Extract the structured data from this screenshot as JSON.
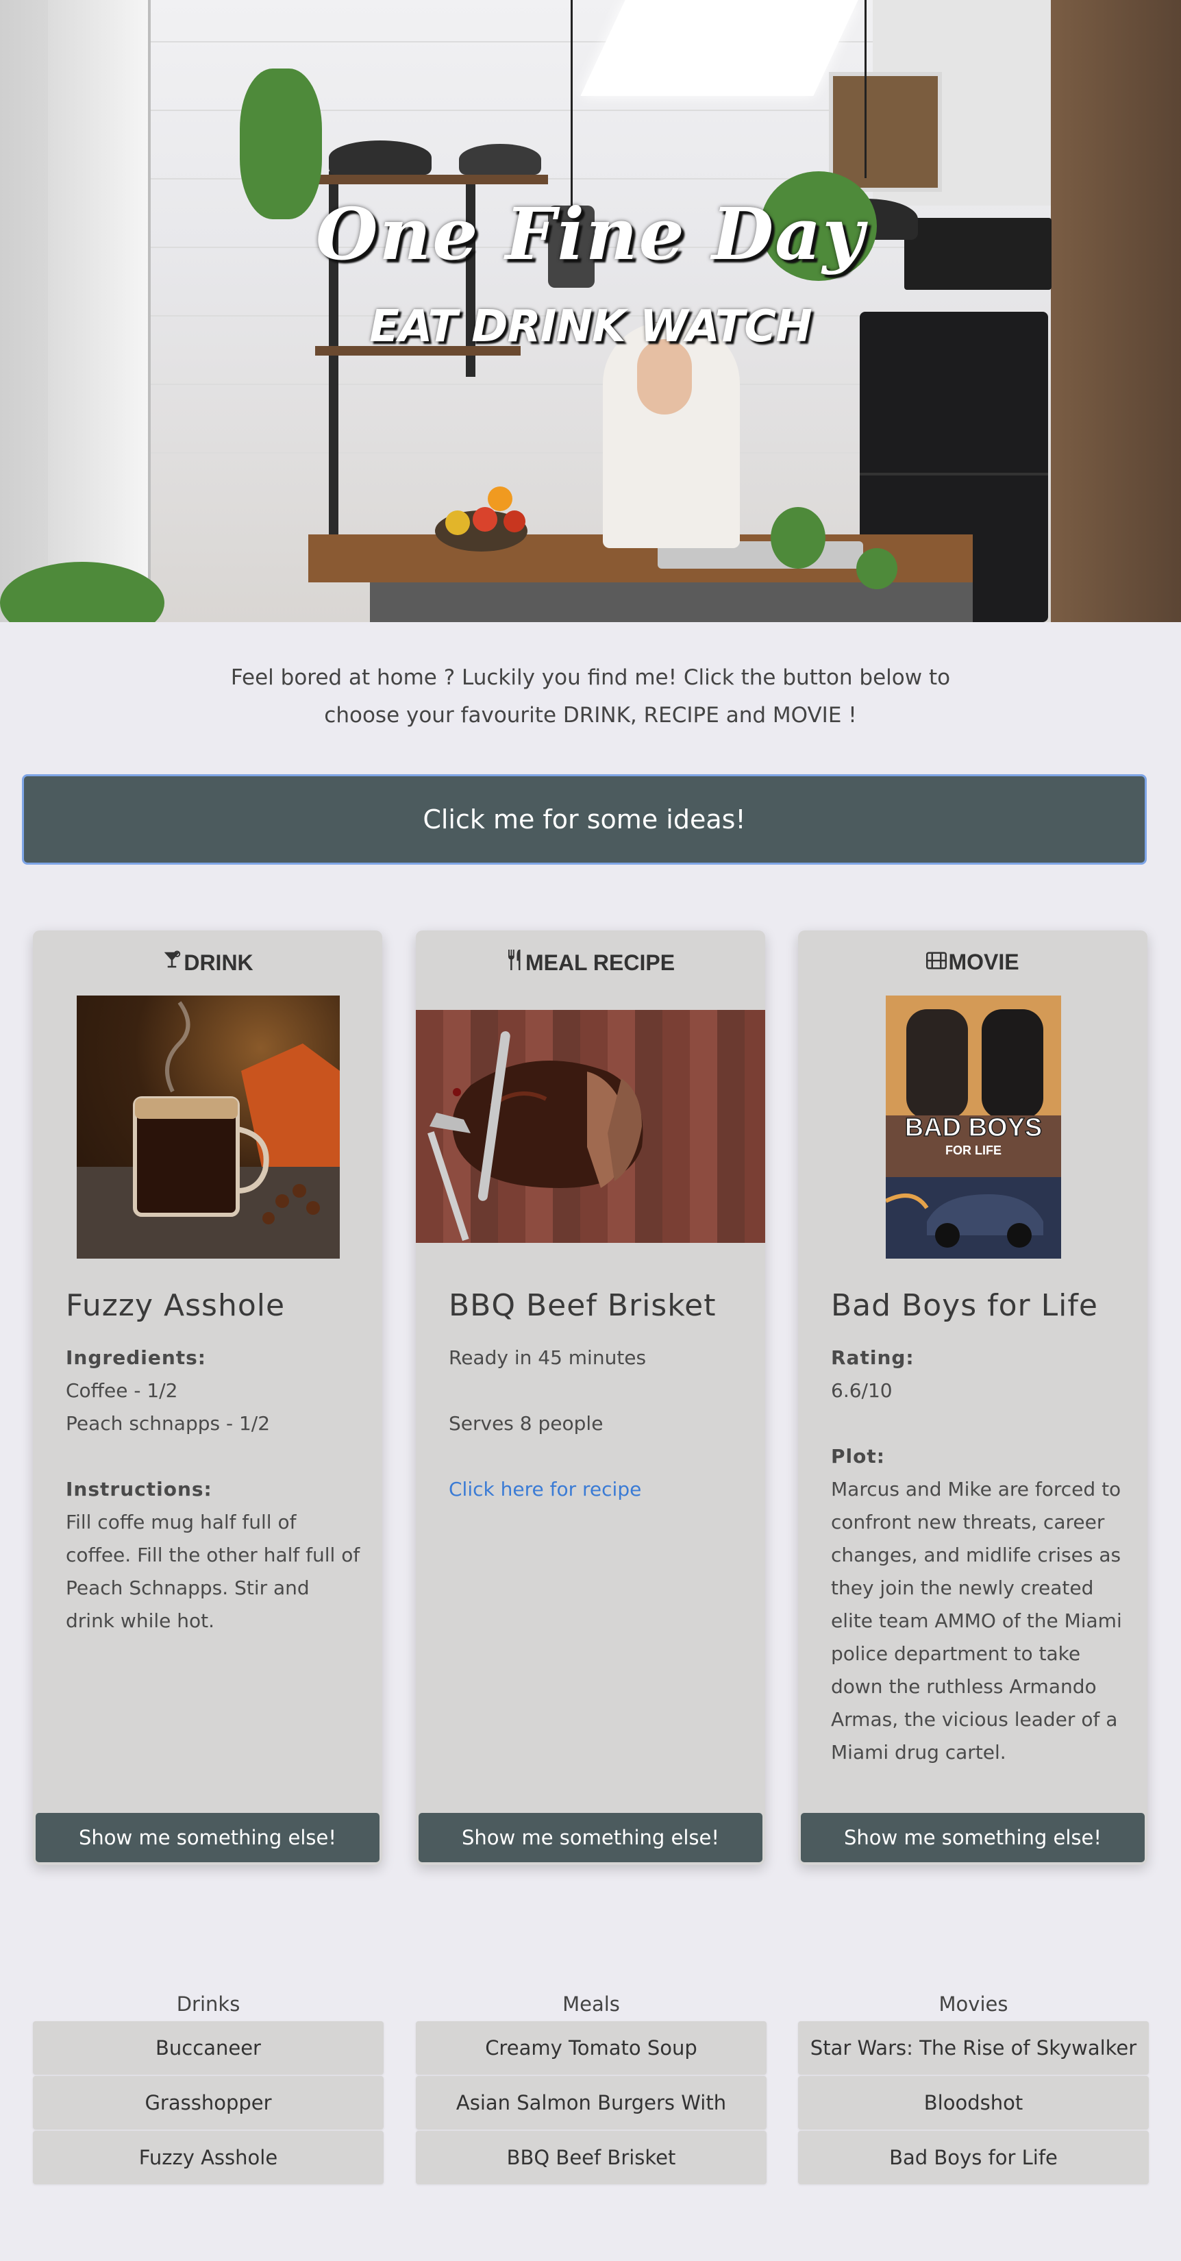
{
  "hero": {
    "title": "One Fine Day",
    "subtitle": "EAT DRINK WATCH"
  },
  "intro": {
    "text": "Feel bored at home ? Luckily you find me! Click the button below to choose your favourite DRINK, RECIPE and MOVIE !"
  },
  "cta": {
    "label": "Click me for some ideas!"
  },
  "cards": {
    "drink": {
      "heading": "DRINK",
      "icon": "cocktail-icon",
      "name": "Fuzzy Asshole",
      "ingredients_label": "Ingredients:",
      "ingredients": [
        "Coffee - 1/2",
        "Peach schnapps - 1/2"
      ],
      "instructions_label": "Instructions:",
      "instructions": "Fill coffe mug half full of coffee. Fill the other half full of Peach Schnapps. Stir and drink while hot.",
      "button": "Show me something else!"
    },
    "meal": {
      "heading": "MEAL RECIPE",
      "icon": "utensils-icon",
      "name": "BBQ Beef Brisket",
      "ready": "Ready in 45 minutes",
      "serves": "Serves 8 people",
      "link": "Click here for recipe",
      "button": "Show me something else!"
    },
    "movie": {
      "heading": "MOVIE",
      "icon": "film-icon",
      "name": "Bad Boys for Life",
      "rating_label": "Rating:",
      "rating": "6.6/10",
      "plot_label": "Plot:",
      "plot": "Marcus and Mike are forced to confront new threats, career changes, and midlife crises as they join the newly created elite team AMMO of the Miami police department to take down the ruthless Armando Armas, the vicious leader of a Miami drug cartel.",
      "poster_title": "BAD BOYS",
      "poster_subtitle": "FOR LIFE",
      "button": "Show me something else!"
    }
  },
  "lists": {
    "drinks": {
      "heading": "Drinks",
      "items": [
        "Buccaneer",
        "Grasshopper",
        "Fuzzy Asshole"
      ]
    },
    "meals": {
      "heading": "Meals",
      "items": [
        "Creamy Tomato Soup",
        "Asian Salmon Burgers With",
        "BBQ Beef Brisket"
      ]
    },
    "movies": {
      "heading": "Movies",
      "items": [
        "Star Wars: The Rise of Skywalker",
        "Bloodshot",
        "Bad Boys for Life"
      ]
    }
  },
  "colors": {
    "background": "#ecebf1",
    "button": "#4c5b5e",
    "card": "#d6d5d4",
    "link": "#3a7bd5",
    "cta_border": "#7ea5e6"
  }
}
